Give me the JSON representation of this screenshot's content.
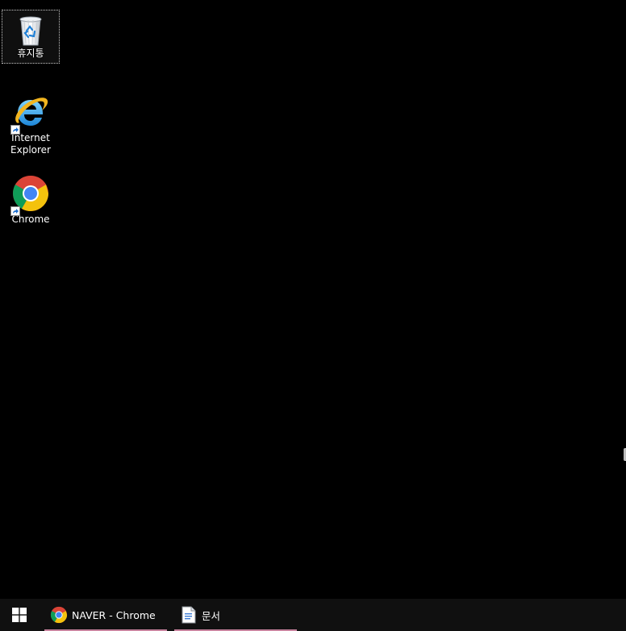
{
  "desktop": {
    "icons": [
      {
        "label": "휴지통",
        "icon": "recycle-bin-icon",
        "selected": true
      },
      {
        "label": "Internet Explorer",
        "icon": "internet-explorer-icon",
        "shortcut": true
      },
      {
        "label": "Chrome",
        "icon": "chrome-icon",
        "shortcut": true
      }
    ]
  },
  "taskbar": {
    "start_icon": "windows-logo-icon",
    "items": [
      {
        "label": "NAVER - Chrome",
        "icon": "chrome-icon"
      },
      {
        "label": "문서",
        "icon": "document-icon"
      }
    ],
    "colors": {
      "background": "#101010",
      "running_indicator": "#c7839e"
    }
  }
}
